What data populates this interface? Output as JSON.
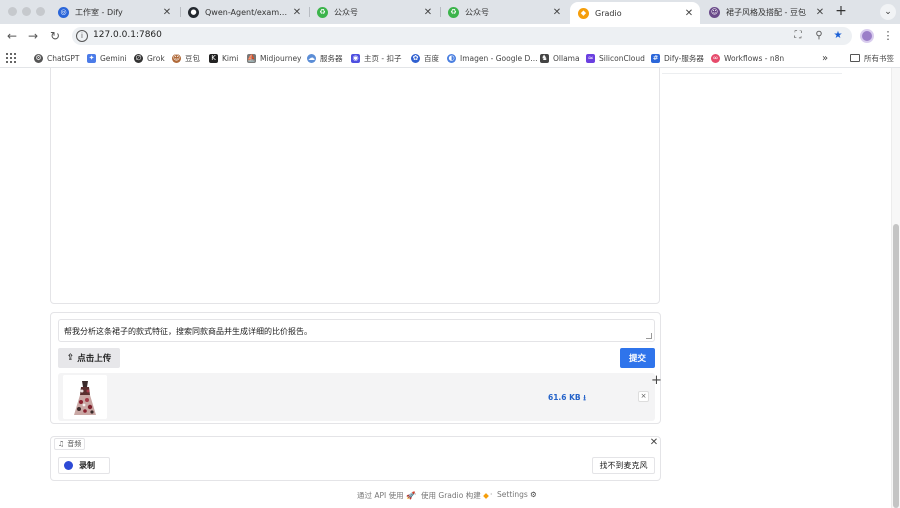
{
  "browser": {
    "tabs": [
      {
        "title": "工作室 - Dify",
        "icon": "dify-icon",
        "color": "#2b66d9",
        "active": false
      },
      {
        "title": "Qwen-Agent/examples/co",
        "icon": "github-icon",
        "color": "#24292f",
        "active": false
      },
      {
        "title": "公众号",
        "icon": "wechat-mp-icon",
        "color": "#3cb44b",
        "active": false
      },
      {
        "title": "公众号",
        "icon": "wechat-mp-icon",
        "color": "#3cb44b",
        "active": false
      },
      {
        "title": "Gradio",
        "icon": "gradio-icon",
        "color": "#f59e0b",
        "active": true
      },
      {
        "title": "裙子风格及搭配 - 豆包",
        "icon": "doubao-icon",
        "color": "#6b4b8a",
        "active": false
      }
    ],
    "new_tab_glyph": "+",
    "tab_close_glyph": "✕",
    "url": "127.0.0.1:7860",
    "bookmarks": [
      {
        "label": "ChatGPT",
        "icon": "chatgpt-icon",
        "color": "#555555"
      },
      {
        "label": "Gemini",
        "icon": "gemini-icon",
        "color": "#4b7be8"
      },
      {
        "label": "Grok",
        "icon": "grok-icon",
        "color": "#333333"
      },
      {
        "label": "豆包",
        "icon": "doubao-icon",
        "color": "#b06a3a"
      },
      {
        "label": "Kimi",
        "icon": "kimi-icon",
        "color": "#222222"
      },
      {
        "label": "Midjourney",
        "icon": "midjourney-icon",
        "color": "#777777"
      },
      {
        "label": "服务器",
        "icon": "cloud-icon",
        "color": "#5b8dd6"
      },
      {
        "label": "主页 - 扣子",
        "icon": "coze-icon",
        "color": "#4e4fe0"
      },
      {
        "label": "百度",
        "icon": "baidu-icon",
        "color": "#3060d0"
      },
      {
        "label": "Imagen - Google D...",
        "icon": "google-deepmind-icon",
        "color": "#4a7fe0"
      },
      {
        "label": "Ollama",
        "icon": "ollama-icon",
        "color": "#444444"
      },
      {
        "label": "SiliconCloud",
        "icon": "siliconcloud-icon",
        "color": "#6a3fe0"
      },
      {
        "label": "Dify-服务器",
        "icon": "dify-icon",
        "color": "#2b66d9"
      },
      {
        "label": "Workflows - n8n",
        "icon": "n8n-icon",
        "color": "#e64a6b"
      }
    ],
    "bookmarks_overflow": "»",
    "all_bookmarks": "所有书签"
  },
  "app": {
    "message": "帮我分析这条裙子的款式特征，搜索同款商品并生成详细的比价报告。",
    "upload_label": "点击上传",
    "submit_label": "提交",
    "file_size": "61.6 KB ⭳",
    "file_remove": "×",
    "add_glyph": "+",
    "audio_label": "音频",
    "audio_close": "✕",
    "record_label": "录制",
    "mic_label": "找不到麦克风",
    "accent": "#2f74eb"
  },
  "footer": {
    "api": "通过 API 使用",
    "built": "使用 Gradio 构建",
    "settings": "Settings",
    "sep": "·"
  }
}
